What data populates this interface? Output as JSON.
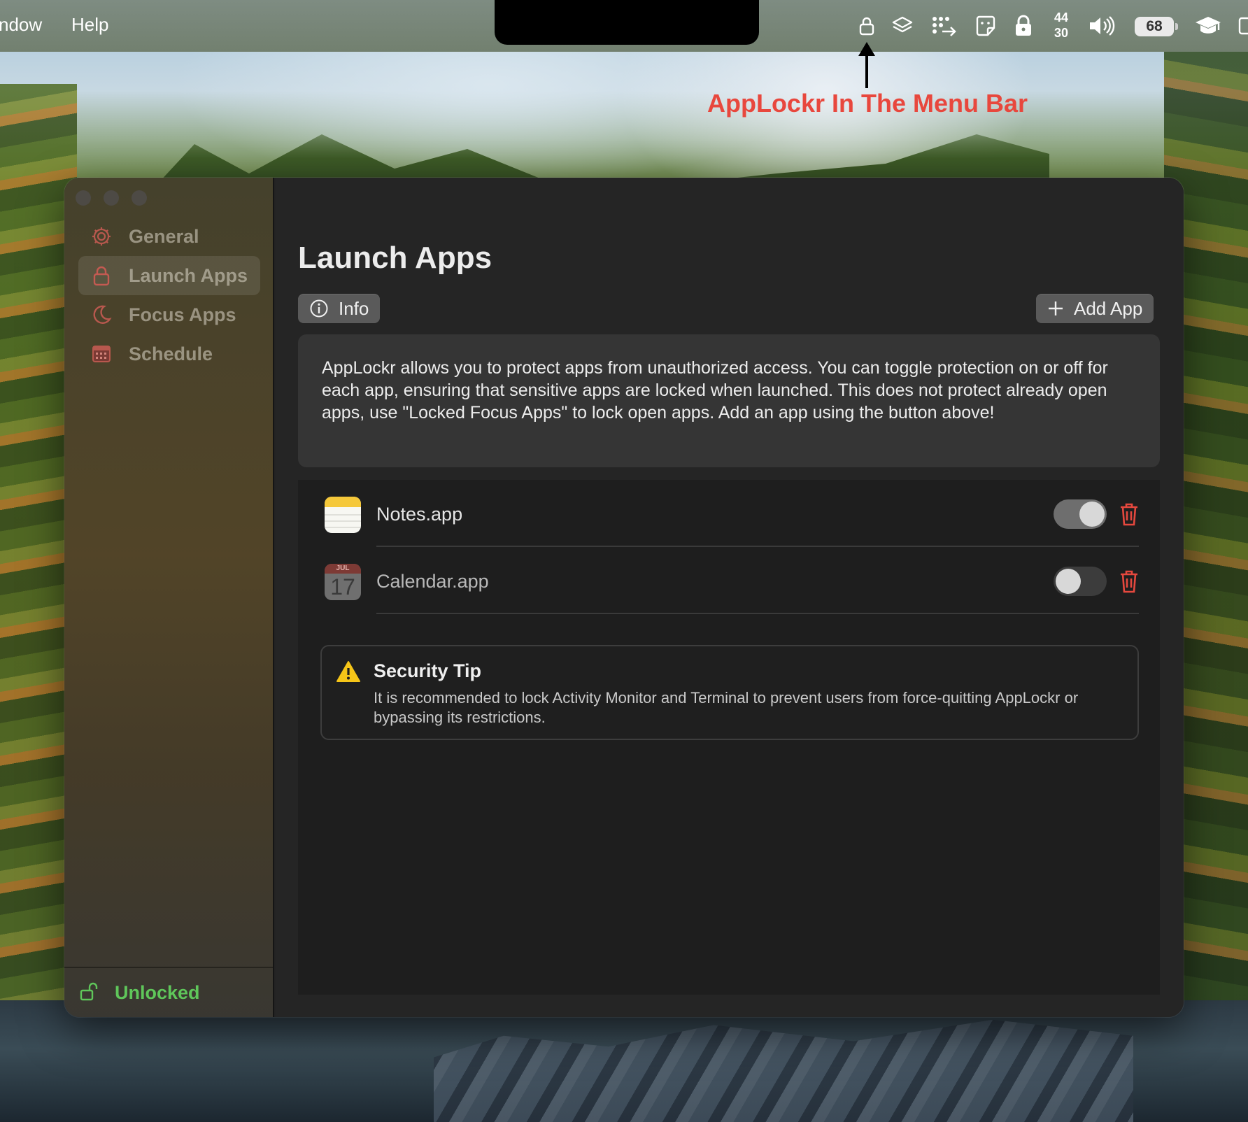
{
  "menubar": {
    "items": [
      "ndow",
      "Help"
    ],
    "clock_top": "44",
    "clock_bottom": "30",
    "battery": "68"
  },
  "annotation": {
    "text": "AppLockr In The Menu Bar",
    "color": "#e8473d"
  },
  "sidebar": {
    "items": [
      {
        "label": "General",
        "icon": "gear-icon"
      },
      {
        "label": "Launch Apps",
        "icon": "lock-icon",
        "selected": true
      },
      {
        "label": "Focus Apps",
        "icon": "moon-icon"
      },
      {
        "label": "Schedule",
        "icon": "calendar-grid-icon"
      }
    ],
    "status": {
      "label": "Unlocked",
      "icon": "unlocked-padlock-icon",
      "color": "#5fc65a"
    }
  },
  "main": {
    "title": "Launch Apps",
    "info_button": "Info",
    "add_button": "Add App",
    "info_text": "AppLockr allows you to protect apps from unauthorized access. You can toggle protection on or off for each app, ensuring that sensitive apps are locked when launched. This does not protect already open apps, use \"Locked Focus Apps\" to lock open apps. Add an app using the button above!",
    "apps": [
      {
        "name": "Notes.app",
        "protected": true
      },
      {
        "name": "Calendar.app",
        "protected": false,
        "calendar_month": "JUL",
        "calendar_day": "17"
      }
    ],
    "tip": {
      "title": "Security Tip",
      "body": "It is recommended to lock Activity Monitor and Terminal to prevent users from force-quitting AppLockr or bypassing its restrictions."
    }
  },
  "colors": {
    "accent_red": "#e5483e",
    "status_green": "#5fc65a",
    "warning_yellow": "#f5c518"
  }
}
